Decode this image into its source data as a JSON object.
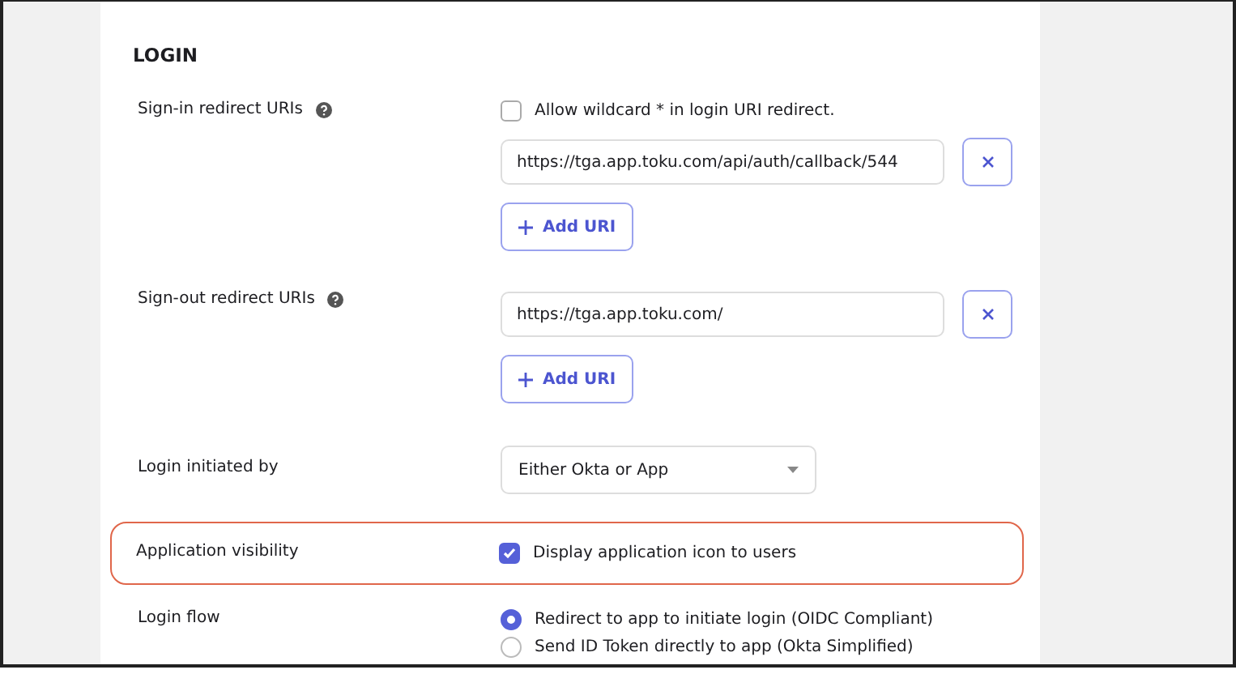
{
  "section": {
    "title": "LOGIN"
  },
  "rows": [
    {
      "kind": "uris",
      "label": "Sign-in redirect URIs",
      "help": true,
      "highlighted": false,
      "wildcard": {
        "label": "Allow wildcard * in login URI redirect.",
        "checked": false
      },
      "uris": [
        "https://tga.app.toku.com/api/auth/callback/544"
      ],
      "add_label": "Add URI"
    },
    {
      "kind": "uris",
      "label": "Sign-out redirect URIs",
      "help": true,
      "highlighted": false,
      "uris": [
        "https://tga.app.toku.com/"
      ],
      "add_label": "Add URI"
    },
    {
      "kind": "select",
      "label": "Login initiated by",
      "help": false,
      "highlighted": false,
      "value": "Either Okta or App"
    },
    {
      "kind": "checkbox",
      "label": "Application visibility",
      "help": false,
      "highlighted": true,
      "option": {
        "label": "Display application icon to users",
        "checked": true
      }
    },
    {
      "kind": "radios",
      "label": "Login flow",
      "help": false,
      "highlighted": false,
      "options": [
        {
          "label": "Redirect to app to initiate login (OIDC Compliant)",
          "selected": true
        },
        {
          "label": "Send ID Token directly to app (Okta Simplified)",
          "selected": false
        }
      ]
    }
  ]
}
